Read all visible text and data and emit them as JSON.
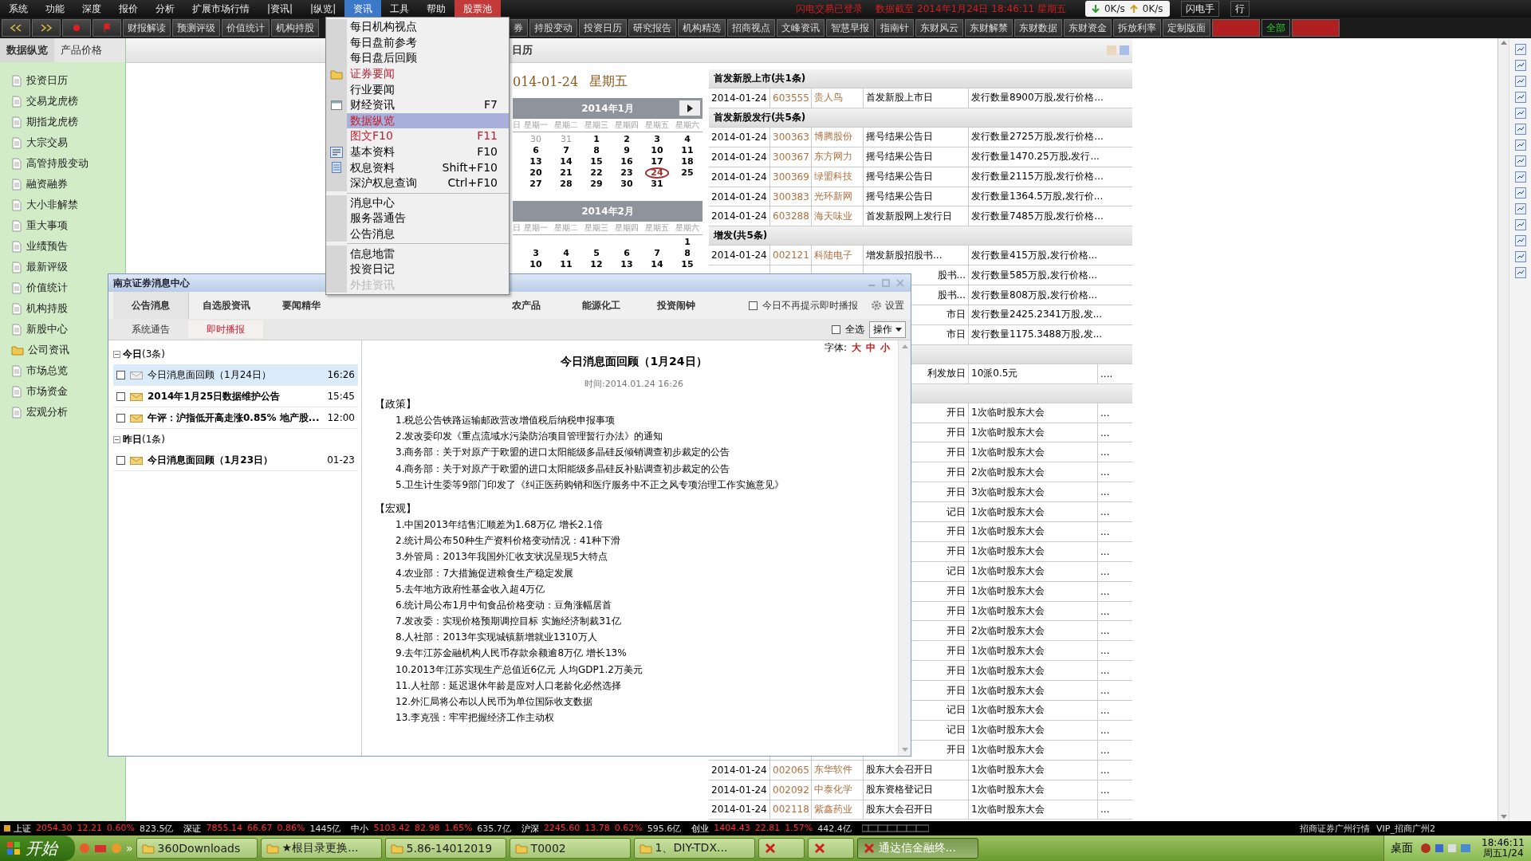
{
  "menubar": {
    "items": [
      {
        "label": "系统",
        "selected": false,
        "accent": false
      },
      {
        "label": "功能",
        "selected": false,
        "accent": false
      },
      {
        "label": "深度",
        "selected": false,
        "accent": false
      },
      {
        "label": "报价",
        "selected": false,
        "accent": false
      },
      {
        "label": "分析",
        "selected": false,
        "accent": false
      },
      {
        "label": "扩展市场行情",
        "selected": false,
        "accent": false
      },
      {
        "label": "|资讯|",
        "selected": false,
        "accent": false
      },
      {
        "label": "|纵览|",
        "selected": false,
        "accent": false
      },
      {
        "label": "资讯",
        "selected": true,
        "accent": false
      },
      {
        "label": "工具",
        "selected": false,
        "accent": false
      },
      {
        "label": "帮助",
        "selected": false,
        "accent": false
      },
      {
        "label": "股票池",
        "selected": false,
        "accent": true
      }
    ],
    "status": "闪电交易已登录",
    "data_time": "数据截至 2014年1月24日 18:46:11 星期五",
    "down_speed": "0K/s",
    "up_speed": "0K/s",
    "buttons": [
      "闪电手",
      "行"
    ]
  },
  "toolbar": {
    "left": [
      {
        "kind": "back"
      },
      {
        "kind": "forward"
      },
      {
        "kind": "red-dot"
      },
      {
        "kind": "red-figure"
      },
      {
        "kind": "text",
        "label": "财报解读"
      },
      {
        "kind": "text",
        "label": "预测评级"
      },
      {
        "kind": "text",
        "label": "价值统计"
      },
      {
        "kind": "text",
        "label": "机构持股"
      }
    ],
    "right": [
      {
        "kind": "text",
        "label": "券"
      },
      {
        "kind": "text",
        "label": "持股变动"
      },
      {
        "kind": "text",
        "label": "投资日历"
      },
      {
        "kind": "text",
        "label": "研究报告"
      },
      {
        "kind": "text",
        "label": "机构精选"
      },
      {
        "kind": "text",
        "label": "招商视点"
      },
      {
        "kind": "text",
        "label": "文峰资讯"
      },
      {
        "kind": "text",
        "label": "智慧早报"
      },
      {
        "kind": "text",
        "label": "指南针"
      },
      {
        "kind": "text",
        "label": "东财风云"
      },
      {
        "kind": "text",
        "label": "东财解禁"
      },
      {
        "kind": "text",
        "label": "东财数据"
      },
      {
        "kind": "text",
        "label": "东财资金"
      },
      {
        "kind": "text",
        "label": "拆放利率"
      },
      {
        "kind": "text",
        "label": "定制版面"
      },
      {
        "kind": "red"
      },
      {
        "kind": "green",
        "label": "全部"
      },
      {
        "kind": "red"
      }
    ]
  },
  "sidebar": {
    "tabs": [
      {
        "label": "数据纵览",
        "selected": true
      },
      {
        "label": "产品价格",
        "selected": false
      }
    ],
    "items": [
      {
        "label": "投资日历",
        "kind": "page"
      },
      {
        "label": "交易龙虎榜",
        "kind": "page"
      },
      {
        "label": "期指龙虎榜",
        "kind": "page"
      },
      {
        "label": "大宗交易",
        "kind": "page"
      },
      {
        "label": "高管持股变动",
        "kind": "page"
      },
      {
        "label": "融资融券",
        "kind": "page"
      },
      {
        "label": "大小非解禁",
        "kind": "page"
      },
      {
        "label": "重大事项",
        "kind": "page"
      },
      {
        "label": "业绩预告",
        "kind": "page"
      },
      {
        "label": "最新评级",
        "kind": "page"
      },
      {
        "label": "价值统计",
        "kind": "page"
      },
      {
        "label": "机构持股",
        "kind": "page"
      },
      {
        "label": "新股中心",
        "kind": "page"
      },
      {
        "label": "公司资讯",
        "kind": "folder"
      },
      {
        "label": "市场总览",
        "kind": "page"
      },
      {
        "label": "市场资金",
        "kind": "page"
      },
      {
        "label": "宏观分析",
        "kind": "page"
      }
    ]
  },
  "content": {
    "title": "日历",
    "date": "014-01-24",
    "weekday": "星期五",
    "calendars": [
      {
        "title": "2014年1月",
        "next_button": true,
        "weekdays": [
          "日",
          "星期一",
          "星期二",
          "星期三",
          "星期四",
          "星期五",
          "星期六"
        ],
        "weeks": [
          [
            {
              "day": "30",
              "other_month": true,
              "selected": false
            },
            {
              "day": "31",
              "other_month": true,
              "selected": false
            },
            {
              "day": "1",
              "other_month": false,
              "selected": false
            },
            {
              "day": "2",
              "other_month": false,
              "selected": false
            },
            {
              "day": "3",
              "other_month": false,
              "selected": false
            },
            {
              "day": "4",
              "other_month": false,
              "selected": false
            }
          ],
          [
            {
              "day": "6",
              "other_month": false,
              "selected": false
            },
            {
              "day": "7",
              "other_month": false,
              "selected": false
            },
            {
              "day": "8",
              "other_month": false,
              "selected": false
            },
            {
              "day": "9",
              "other_month": false,
              "selected": false
            },
            {
              "day": "10",
              "other_month": false,
              "selected": false
            },
            {
              "day": "11",
              "other_month": false,
              "selected": false
            }
          ],
          [
            {
              "day": "13",
              "other_month": false,
              "selected": false
            },
            {
              "day": "14",
              "other_month": false,
              "selected": false
            },
            {
              "day": "15",
              "other_month": false,
              "selected": false
            },
            {
              "day": "16",
              "other_month": false,
              "selected": false
            },
            {
              "day": "17",
              "other_month": false,
              "selected": false
            },
            {
              "day": "18",
              "other_month": false,
              "selected": false
            }
          ],
          [
            {
              "day": "20",
              "other_month": false,
              "selected": false
            },
            {
              "day": "21",
              "other_month": false,
              "selected": false
            },
            {
              "day": "22",
              "other_month": false,
              "selected": false
            },
            {
              "day": "23",
              "other_month": false,
              "selected": false
            },
            {
              "day": "24",
              "other_month": false,
              "selected": true
            },
            {
              "day": "25",
              "other_month": false,
              "selected": false
            }
          ],
          [
            {
              "day": "27",
              "other_month": false,
              "selected": false
            },
            {
              "day": "28",
              "other_month": false,
              "selected": false
            },
            {
              "day": "29",
              "other_month": false,
              "selected": false
            },
            {
              "day": "30",
              "other_month": false,
              "selected": false
            },
            {
              "day": "31",
              "other_month": false,
              "selected": false
            }
          ]
        ]
      },
      {
        "title": "2014年2月",
        "next_button": false,
        "weekdays": [
          "日",
          "星期一",
          "星期二",
          "星期三",
          "星期四",
          "星期五",
          "星期六"
        ],
        "weeks": [
          [
            {
              "day": "1",
              "other_month": false,
              "selected": false
            }
          ],
          [
            {
              "day": "3",
              "other_month": false,
              "selected": false
            },
            {
              "day": "4",
              "other_month": false,
              "selected": false
            },
            {
              "day": "5",
              "other_month": false,
              "selected": false
            },
            {
              "day": "6",
              "other_month": false,
              "selected": false
            },
            {
              "day": "7",
              "other_month": false,
              "selected": false
            },
            {
              "day": "8",
              "other_month": false,
              "selected": false
            }
          ],
          [
            {
              "day": "10",
              "other_month": false,
              "selected": false
            },
            {
              "day": "11",
              "other_month": false,
              "selected": false
            },
            {
              "day": "12",
              "other_month": false,
              "selected": false
            },
            {
              "day": "13",
              "other_month": false,
              "selected": false
            },
            {
              "day": "14",
              "other_month": false,
              "selected": false
            },
            {
              "day": "15",
              "other_month": false,
              "selected": false
            }
          ]
        ]
      }
    ],
    "sections": [
      {
        "title": "首发新股上市(共1条)",
        "rows": [
          {
            "kind": "full",
            "date": "2014-01-24",
            "code": "603555",
            "name": "贵人鸟",
            "event": "首发新股上市日",
            "detail": "发行数量8900万股,发行价格..."
          }
        ]
      },
      {
        "title": "首发新股发行(共5条)",
        "rows": [
          {
            "kind": "full",
            "date": "2014-01-24",
            "code": "300363",
            "name": "博腾股份",
            "event": "摇号结果公告日",
            "detail": "发行数量2725万股,发行价格..."
          },
          {
            "kind": "full",
            "date": "2014-01-24",
            "code": "300367",
            "name": "东方网力",
            "event": "摇号结果公告日",
            "detail": "发行数量1470.25万股,发行..."
          },
          {
            "kind": "full",
            "date": "2014-01-24",
            "code": "300369",
            "name": "绿盟科技",
            "event": "摇号结果公告日",
            "detail": "发行数量2115万股,发行价格..."
          },
          {
            "kind": "full",
            "date": "2014-01-24",
            "code": "300383",
            "name": "光环新网",
            "event": "摇号结果公告日",
            "detail": "发行数量1364.5万股,发行价..."
          },
          {
            "kind": "full",
            "date": "2014-01-24",
            "code": "603288",
            "name": "海天味业",
            "event": "首发新股网上发行日",
            "detail": "发行数量7485万股,发行价格..."
          }
        ]
      },
      {
        "title": "增发(共5条)",
        "rows": [
          {
            "kind": "full",
            "date": "2014-01-24",
            "code": "002121",
            "name": "科陆电子",
            "event": "增发新股招股书...",
            "detail": "发行数量415万股,发行价格..."
          },
          {
            "kind": "partial",
            "event": "股书...",
            "detail": "发行数量585万股,发行价格..."
          },
          {
            "kind": "partial",
            "event": "股书...",
            "detail": "发行数量808万股,发行价格..."
          },
          {
            "kind": "partial",
            "event": "市日",
            "detail": "发行数量2425.2341万股,发..."
          },
          {
            "kind": "partial",
            "event": "市日",
            "detail": "发行数量1175.3488万股,发..."
          }
        ]
      },
      {
        "rows": [
          {
            "kind": "partial",
            "event": "利发放日",
            "detail": "10派0.5元",
            "more": "...."
          }
        ]
      },
      {
        "rows": [
          {
            "kind": "partial",
            "event": "开日",
            "detail": "1次临时股东大会",
            "more": "..."
          },
          {
            "kind": "partial",
            "event": "开日",
            "detail": "1次临时股东大会",
            "more": "..."
          },
          {
            "kind": "partial",
            "event": "开日",
            "detail": "1次临时股东大会",
            "more": "..."
          },
          {
            "kind": "partial",
            "event": "开日",
            "detail": "2次临时股东大会",
            "more": "..."
          },
          {
            "kind": "partial",
            "event": "开日",
            "detail": "3次临时股东大会",
            "more": "..."
          },
          {
            "kind": "partial",
            "event": "记日",
            "detail": "1次临时股东大会",
            "more": "..."
          },
          {
            "kind": "partial",
            "event": "开日",
            "detail": "1次临时股东大会",
            "more": "..."
          },
          {
            "kind": "partial",
            "event": "开日",
            "detail": "1次临时股东大会",
            "more": "..."
          },
          {
            "kind": "partial",
            "event": "记日",
            "detail": "1次临时股东大会",
            "more": "..."
          },
          {
            "kind": "partial",
            "event": "开日",
            "detail": "1次临时股东大会",
            "more": "..."
          },
          {
            "kind": "partial",
            "event": "开日",
            "detail": "1次临时股东大会",
            "more": "..."
          },
          {
            "kind": "partial",
            "event": "开日",
            "detail": "2次临时股东大会",
            "more": "..."
          },
          {
            "kind": "partial",
            "event": "开日",
            "detail": "1次临时股东大会",
            "more": "..."
          },
          {
            "kind": "partial",
            "event": "开日",
            "detail": "1次临时股东大会",
            "more": "..."
          },
          {
            "kind": "partial",
            "event": "开日",
            "detail": "1次临时股东大会",
            "more": "..."
          },
          {
            "kind": "partial",
            "event": "记日",
            "detail": "1次临时股东大会",
            "more": "..."
          },
          {
            "kind": "partial",
            "event": "记日",
            "detail": "1次临时股东大会",
            "more": "..."
          },
          {
            "kind": "partial",
            "event": "开日",
            "detail": "1次临时股东大会",
            "more": "..."
          },
          {
            "kind": "full",
            "date": "2014-01-24",
            "code": "002065",
            "name": "东华软件",
            "event": "股东大会召开日",
            "detail": "1次临时股东大会",
            "more": "..."
          },
          {
            "kind": "full",
            "date": "2014-01-24",
            "code": "002092",
            "name": "中泰化学",
            "event": "股东资格登记日",
            "detail": "1次临时股东大会",
            "more": "..."
          },
          {
            "kind": "full",
            "date": "2014-01-24",
            "code": "002118",
            "name": "紫鑫药业",
            "event": "股东大会召开日",
            "detail": "1次临时股东大会",
            "more": "..."
          }
        ]
      }
    ]
  },
  "dropdown": {
    "items": [
      {
        "kind": "plain",
        "label": "每日机构视点",
        "selected": false,
        "disabled": false,
        "accent": false
      },
      {
        "kind": "plain",
        "label": "每日盘前参考",
        "selected": false,
        "disabled": false,
        "accent": false
      },
      {
        "kind": "plain",
        "label": "每日盘后回顾",
        "selected": false,
        "disabled": false,
        "accent": false
      },
      {
        "kind": "folder",
        "label": "证券要闻",
        "selected": false,
        "disabled": false,
        "accent": true
      },
      {
        "kind": "plain",
        "label": "行业要闻",
        "selected": false,
        "disabled": false,
        "accent": false
      },
      {
        "kind": "window",
        "label": "财经资讯",
        "shortcut": "F7",
        "selected": false,
        "disabled": false,
        "accent": false
      },
      {
        "kind": "plain",
        "label": "数据纵览",
        "selected": true,
        "disabled": false,
        "accent": true
      },
      {
        "kind": "plain",
        "label": "图文F10",
        "shortcut": "F11",
        "selected": false,
        "disabled": false,
        "accent": true
      },
      {
        "kind": "f10",
        "label": "基本资料",
        "shortcut": "F10",
        "selected": false,
        "disabled": false,
        "accent": false
      },
      {
        "kind": "list",
        "label": "权息资料",
        "shortcut": "Shift+F10",
        "selected": false,
        "disabled": false,
        "accent": false
      },
      {
        "kind": "plain",
        "label": "深沪权息查询",
        "shortcut": "Ctrl+F10",
        "selected": false,
        "disabled": false,
        "accent": false
      },
      {
        "kind": "separator"
      },
      {
        "kind": "plain",
        "label": "消息中心",
        "selected": false,
        "disabled": false,
        "accent": false
      },
      {
        "kind": "plain",
        "label": "服务器通告",
        "selected": false,
        "disabled": false,
        "accent": false
      },
      {
        "kind": "plain",
        "label": "公告消息",
        "selected": false,
        "disabled": false,
        "accent": false
      },
      {
        "kind": "separator"
      },
      {
        "kind": "plain",
        "label": "信息地雷",
        "selected": false,
        "disabled": false,
        "accent": false
      },
      {
        "kind": "plain",
        "label": "投资日记",
        "selected": false,
        "disabled": false,
        "accent": false
      },
      {
        "kind": "plain",
        "label": "外挂资讯",
        "selected": false,
        "disabled": true,
        "accent": false
      }
    ]
  },
  "message_center": {
    "title": "南京证券消息中心",
    "tabs": [
      {
        "label": "公告消息",
        "selected": true
      },
      {
        "label": "自选股资讯",
        "selected": false
      },
      {
        "label": "要闻精华",
        "selected": false
      },
      {
        "label": "农产品",
        "selected": false
      },
      {
        "label": "能源化工",
        "selected": false
      },
      {
        "label": "投资闹钟",
        "selected": false
      }
    ],
    "mute_option": {
      "label": "今日不再提示即时播报",
      "checked": false
    },
    "settings": "设置",
    "subtabs": [
      {
        "label": "系统通告",
        "selected": false
      },
      {
        "label": "即时播报",
        "selected": true
      }
    ],
    "select_all": {
      "label": "全选",
      "checked": false
    },
    "actions": "操作",
    "groups": [
      {
        "title": "**今日**(3条)",
        "expanded": true,
        "items": [
          {
            "title": "今日消息面回顾（1月24日）",
            "time": "16:26",
            "checked": false,
            "read": true,
            "selected": true
          },
          {
            "title": "2014年1月25日数据维护公告",
            "time": "15:45",
            "checked": false,
            "read": false,
            "selected": false
          },
          {
            "title": "午评：沪指低开高走涨0.85% 地产股...",
            "time": "12:00",
            "checked": false,
            "read": false,
            "selected": false
          }
        ]
      },
      {
        "title": "**昨日**(1条)",
        "expanded": true,
        "items": [
          {
            "title": "今日消息面回顾（1月23日）",
            "time": "01-23",
            "checked": false,
            "read": false,
            "selected": false
          }
        ]
      }
    ],
    "font_label": "字体:",
    "font_sizes": [
      "大",
      "中",
      "小"
    ],
    "article": {
      "title": "今日消息面回顾（1月24日）",
      "time": "时间:2014.01.24 16:26",
      "sections": [
        {
          "heading": "【政策】",
          "items": [
            "1.税总公告铁路运输邮政营改增值税后纳税申报事项",
            "2.发改委印发《重点流域水污染防治项目管理暂行办法》的通知",
            "3.商务部：关于对原产于欧盟的进口太阳能级多晶硅反倾销调查初步裁定的公告",
            "4.商务部：关于对原产于欧盟的进口太阳能级多晶硅反补贴调查初步裁定的公告",
            "5.卫生计生委等9部门印发了《纠正医药购销和医疗服务中不正之风专项治理工作实施意见》"
          ]
        },
        {
          "heading": "【宏观】",
          "items": [
            "1.中国2013年结售汇顺差为1.68万亿 增长2.1倍",
            "2.统计局公布50种生产资料价格变动情况：41种下滑",
            "3.外管局：2013年我国外汇收支状况呈现5大特点",
            "4.农业部：7大措施促进粮食生产稳定发展",
            "5.去年地方政府性基金收入超4万亿",
            "6.统计局公布1月中旬食品价格变动：豆角涨幅居首",
            "7.发改委：实现价格预期调控目标 实施经济制裁31亿",
            "8.人社部：2013年实现城镇新增就业1310万人",
            "9.去年江苏金融机构人民币存款余额逾8万亿 增长13%",
            "10.2013年江苏实现生产总值近6亿元 人均GDP1.2万美元",
            "11.人社部：延迟退休年龄是应对人口老龄化必然选择",
            "12.外汇局将公布以人民币为单位国际收支数据",
            "13.李克强：牢牢把握经济工作主动权"
          ]
        }
      ]
    }
  },
  "status_bar": {
    "indices": [
      {
        "label": "上证",
        "value": "2054.30",
        "change": "12.21",
        "pct": "0.60%",
        "amount": "823.5亿",
        "up": true
      },
      {
        "label": "深证",
        "value": "7855.14",
        "change": "66.67",
        "pct": "0.86%",
        "amount": "1445亿",
        "up": true
      },
      {
        "label": "中小",
        "value": "5103.42",
        "change": "82.98",
        "pct": "1.65%",
        "amount": "635.7亿",
        "up": true
      },
      {
        "label": "沪深",
        "value": "2245.60",
        "change": "13.78",
        "pct": "0.62%",
        "amount": "595.6亿",
        "up": true
      },
      {
        "label": "创业",
        "value": "1404.43",
        "change": "22.81",
        "pct": "1.57%",
        "amount": "442.4亿",
        "up": true
      }
    ],
    "broker": "招商证券广州行情",
    "account": "VIP_招商广州2"
  },
  "taskbar": {
    "start": "开始",
    "more": "»",
    "tasks": [
      {
        "label": "360Downloads",
        "kind": "folder",
        "selected": false
      },
      {
        "label": "★根目录更换...",
        "kind": "folder",
        "selected": false
      },
      {
        "label": "5.86-14012019",
        "kind": "folder",
        "selected": false
      },
      {
        "label": "T0002",
        "kind": "folder",
        "selected": false
      },
      {
        "label": "1、DIY-TDX...",
        "kind": "folder",
        "selected": false
      },
      {
        "kind": "app",
        "selected": false
      },
      {
        "kind": "app",
        "selected": false
      },
      {
        "label": "通达信金融终...",
        "kind": "app",
        "selected": true
      }
    ],
    "desktop": "桌面",
    "time": "18:46:11",
    "date": "周五1/24"
  }
}
